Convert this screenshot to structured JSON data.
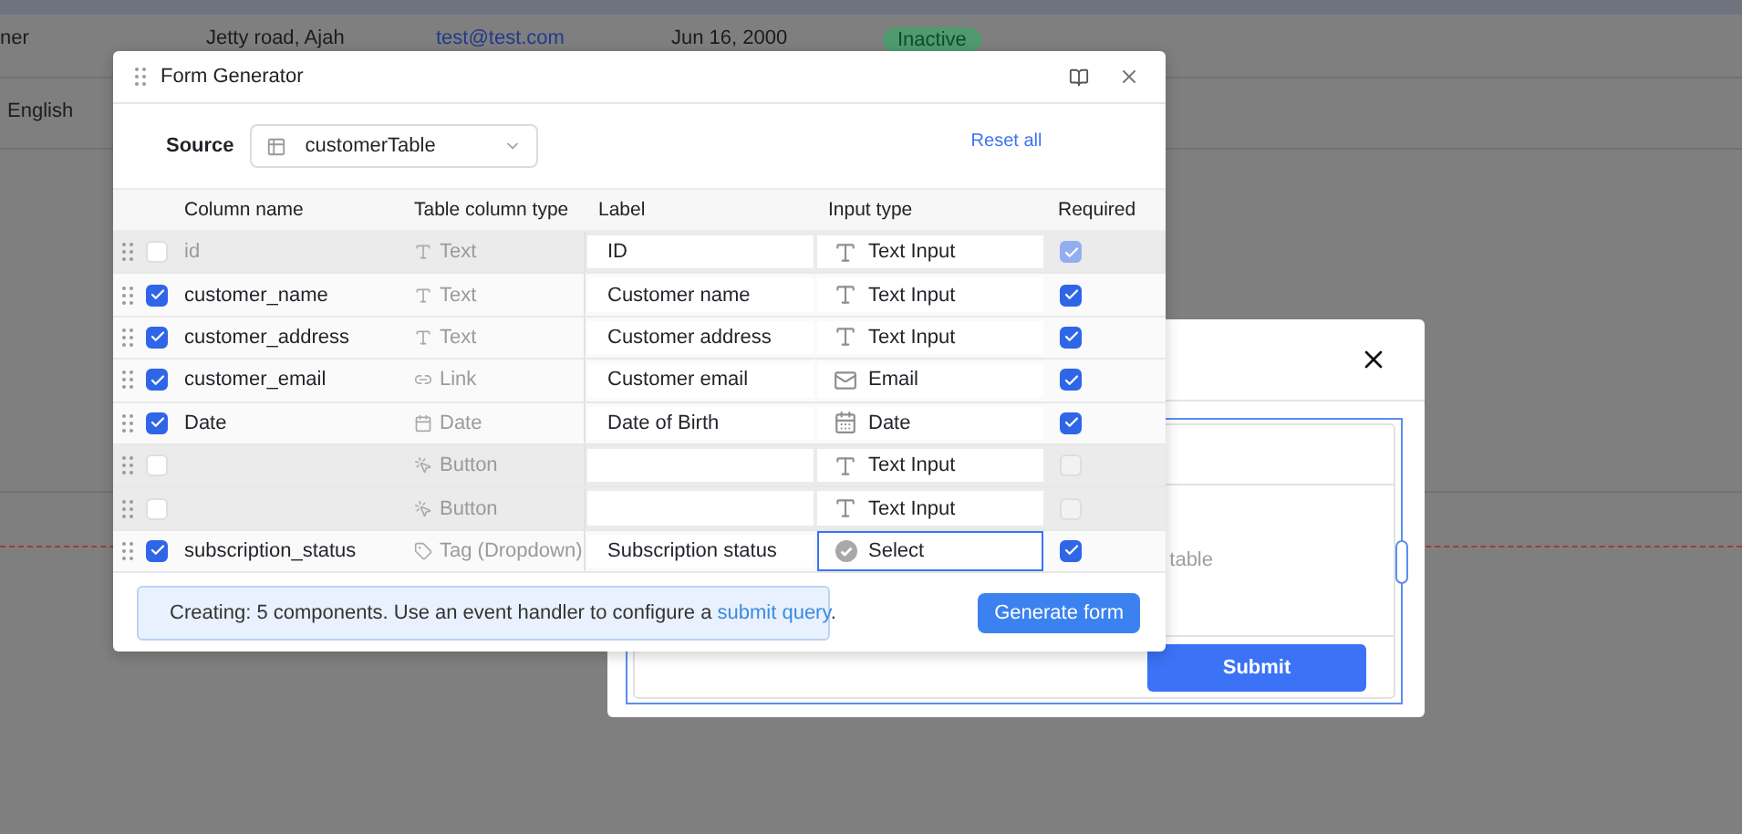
{
  "background_table": {
    "rows": [
      {
        "cells": [
          {
            "kind": "text",
            "text": "ner"
          },
          {
            "kind": "text",
            "text": "Jetty road, Ajah"
          },
          {
            "kind": "link",
            "text": "test@test.com"
          },
          {
            "kind": "text",
            "text": "Jun 16, 2000"
          },
          {
            "kind": "badge",
            "text": "Inactive"
          }
        ]
      },
      {
        "cells": [
          {
            "kind": "text",
            "text": "English"
          }
        ]
      }
    ]
  },
  "back_dialog": {
    "hint": "table",
    "button": "Submit"
  },
  "form_generator": {
    "title": "Form Generator",
    "source_label": "Source",
    "source_value": "customerTable",
    "reset": "Reset all",
    "columns": [
      "Column name",
      "Table column type",
      "Label",
      "Input type",
      "Required"
    ],
    "rows": [
      {
        "name": "id",
        "checked": false,
        "column_type": {
          "kind": "text",
          "text": "Text"
        },
        "label": "ID",
        "input_type": {
          "kind": "text",
          "text": "Text Input"
        },
        "focused": false,
        "required": {
          "checked": true,
          "disabled": true
        }
      },
      {
        "name": "customer_name",
        "checked": true,
        "column_type": {
          "kind": "text",
          "text": "Text"
        },
        "label": "Customer name",
        "input_type": {
          "kind": "text",
          "text": "Text Input"
        },
        "focused": false,
        "required": {
          "checked": true,
          "disabled": false
        }
      },
      {
        "name": "customer_address",
        "checked": true,
        "column_type": {
          "kind": "text",
          "text": "Text"
        },
        "label": "Customer address",
        "input_type": {
          "kind": "text",
          "text": "Text Input"
        },
        "focused": false,
        "required": {
          "checked": true,
          "disabled": false
        }
      },
      {
        "name": "customer_email",
        "checked": true,
        "column_type": {
          "kind": "link",
          "text": "Link"
        },
        "label": "Customer email",
        "input_type": {
          "kind": "email",
          "text": "Email"
        },
        "focused": false,
        "required": {
          "checked": true,
          "disabled": false
        }
      },
      {
        "name": "Date",
        "checked": true,
        "column_type": {
          "kind": "date",
          "text": "Date"
        },
        "label": "Date of Birth",
        "input_type": {
          "kind": "date",
          "text": "Date"
        },
        "focused": false,
        "required": {
          "checked": true,
          "disabled": false
        }
      },
      {
        "checked": false,
        "column_type": {
          "kind": "button",
          "text": "Button"
        },
        "input_type": {
          "kind": "text",
          "text": "Text Input"
        },
        "focused": false,
        "required": {
          "checked": false,
          "disabled": true
        }
      },
      {
        "checked": false,
        "column_type": {
          "kind": "button",
          "text": "Button"
        },
        "input_type": {
          "kind": "text",
          "text": "Text Input"
        },
        "focused": false,
        "required": {
          "checked": false,
          "disabled": true
        }
      },
      {
        "name": "subscription_status",
        "checked": true,
        "column_type": {
          "kind": "tag",
          "text": "Tag (Dropdown)"
        },
        "label": "Subscription status",
        "input_type": {
          "kind": "select",
          "text": "Select"
        },
        "focused": true,
        "required": {
          "checked": true,
          "disabled": false
        }
      }
    ],
    "info": {
      "text": "Creating: 5 components. Use an event handler to configure a ",
      "link": "submit query",
      "end": "."
    },
    "generate": "Generate form"
  }
}
